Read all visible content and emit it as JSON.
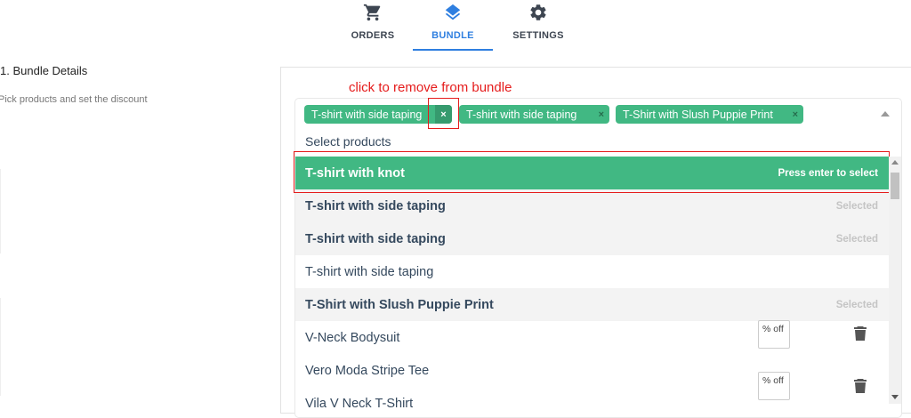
{
  "tabs": [
    {
      "label": "ORDERS",
      "icon": "cart-icon",
      "active": false
    },
    {
      "label": "BUNDLE",
      "icon": "layers-icon",
      "active": true
    },
    {
      "label": "SETTINGS",
      "icon": "gear-icon",
      "active": false
    }
  ],
  "section": {
    "title": "1. Bundle Details",
    "subtitle": "Pick products and set the discount"
  },
  "annotation": "click to remove from bundle",
  "multiselect": {
    "placeholder": "Select products",
    "selected_tags": [
      {
        "label": "T-shirt with side taping",
        "remove": "×"
      },
      {
        "label": "T-shirt with side taping",
        "remove": "×"
      },
      {
        "label": "T-Shirt with Slush Puppie Print",
        "remove": "×"
      }
    ],
    "options": [
      {
        "label": "T-shirt with knot",
        "hint": "Press enter to select",
        "state": "highlighted"
      },
      {
        "label": "T-shirt with side taping",
        "hint": "Selected",
        "state": "selected"
      },
      {
        "label": "T-shirt with side taping",
        "hint": "Selected",
        "state": "selected"
      },
      {
        "label": "T-shirt with side taping",
        "hint": "",
        "state": "normal"
      },
      {
        "label": "T-Shirt with Slush Puppie Print",
        "hint": "Selected",
        "state": "selected"
      },
      {
        "label": "V-Neck Bodysuit",
        "hint": "",
        "state": "normal"
      },
      {
        "label": "Vero Moda Stripe Tee",
        "hint": "",
        "state": "normal"
      },
      {
        "label": "Vila V Neck T-Shirt",
        "hint": "",
        "state": "normal"
      }
    ]
  },
  "discount_fields": [
    {
      "placeholder": "% off"
    },
    {
      "placeholder": "% off"
    }
  ],
  "colors": {
    "accent_blue": "#2f7fe0",
    "tag_green": "#41b883",
    "annotation_red": "#e51c1c"
  }
}
